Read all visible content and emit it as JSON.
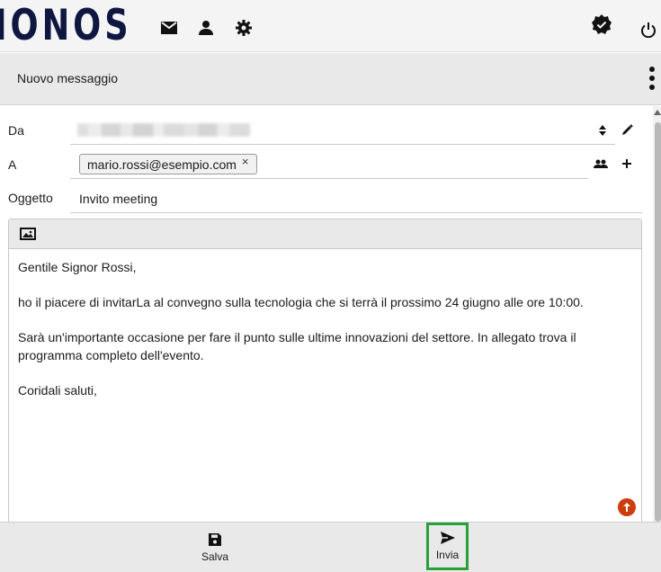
{
  "header": {
    "logo_text": "IONOS",
    "icons": [
      "mail-icon",
      "contacts-icon",
      "settings-icon",
      "verified-badge-icon",
      "power-icon"
    ]
  },
  "toolbar": {
    "title": "Nuovo messaggio"
  },
  "form": {
    "from_label": "Da",
    "to_label": "A",
    "subject_label": "Oggetto",
    "recipient": "mario.rossi@esempio.com",
    "recipient_remove": "×",
    "subject": "Invito meeting"
  },
  "editor": {
    "toolbar_icon": "insert-image-icon",
    "body": [
      "Gentile Signor Rossi,",
      "ho il piacere di invitarLa al convegno sulla tecnologia che si terrà il prossimo 24 giugno alle ore 10:00.",
      "Sarà un'importante occasione per fare il punto sulle ultime innovazioni del settore. In allegato trova il programma completo dell'evento.",
      "Coridali saluti,"
    ]
  },
  "footer": {
    "save_label": "Salva",
    "send_label": "Invia"
  },
  "colors": {
    "brand": "#0f1640",
    "send_highlight": "#27a138",
    "scroll_up_badge": "#cc3d0e"
  }
}
